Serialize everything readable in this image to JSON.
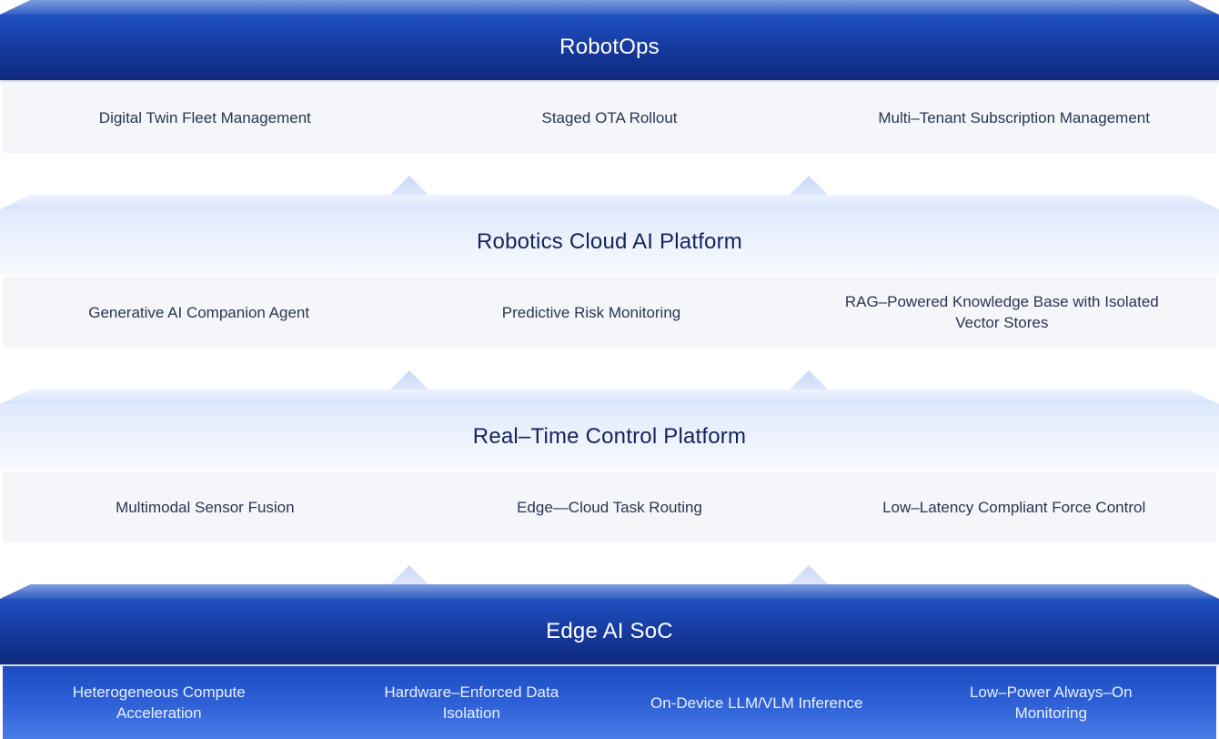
{
  "layers": [
    {
      "title": "RobotOps",
      "items": [
        "Digital Twin Fleet Management",
        "Staged OTA Rollout",
        "Multi–Tenant Subscription Management"
      ]
    },
    {
      "title": "Robotics Cloud AI Platform",
      "items": [
        "Generative AI Companion Agent",
        "Predictive Risk Monitoring",
        "RAG–Powered Knowledge Base with Isolated Vector Stores"
      ]
    },
    {
      "title": "Real–Time Control Platform",
      "items": [
        "Multimodal Sensor Fusion",
        "Edge—Cloud Task Routing",
        "Low–Latency Compliant Force Control"
      ]
    },
    {
      "title": "Edge AI SoC",
      "items": [
        "Heterogeneous Compute Acceleration",
        "Hardware–Enforced Data Isolation",
        "On-Device LLM/VLM Inference",
        "Low–Power Always–On Monitoring"
      ]
    }
  ],
  "colors": {
    "dark_bar": "#15389a",
    "light_bar": "#eef3fd",
    "item_row": "#f5f6fa",
    "soc_row": "#2d60d6",
    "connector": "#d3e0f8"
  }
}
